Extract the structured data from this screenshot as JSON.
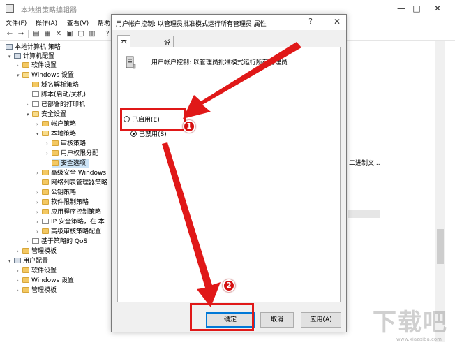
{
  "window": {
    "title": "本地组策略编辑器",
    "controls": {
      "minimize": "—",
      "maximize": "□",
      "close": "✕"
    }
  },
  "menu": {
    "items": [
      "文件(F)",
      "操作(A)",
      "查看(V)",
      "帮助"
    ]
  },
  "tree": {
    "root": "本地计算机 策略",
    "computer_config": "计算机配置",
    "software_settings": "软件设置",
    "windows_settings": "Windows 设置",
    "name_resolution": "域名解析策略",
    "scripts": "脚本(启动/关机)",
    "printers": "已部署的打印机",
    "security_settings": "安全设置",
    "account_policies": "帐户策略",
    "local_policies": "本地策略",
    "audit_policy": "审核策略",
    "user_rights": "用户权限分配",
    "security_options": "安全选项",
    "adv_firewall": "高级安全 Windows",
    "network_list": "网络列表管理器策略",
    "public_key": "公钥策略",
    "software_restriction": "软件限制策略",
    "app_control": "应用程序控制策略",
    "ip_security": "IP 安全策略，在 本",
    "adv_audit": "高级审核策略配置",
    "qos": "基于策略的 QoS",
    "admin_templates": "管理模板",
    "user_config": "用户配置",
    "u_software": "软件设置",
    "u_windows": "Windows 设置",
    "u_admin": "管理模板"
  },
  "right_panel": {
    "partial_text": "二进制文..."
  },
  "dialog": {
    "title": "用户帐户控制: 以管理员批准模式运行所有管理员 属性",
    "close": "?",
    "close_x": "✕",
    "tabs": [
      "本地安全设置",
      "说明"
    ],
    "policy_name": "用户帐户控制: 以管理员批准模式运行所有管理员",
    "options": {
      "enabled": "已启用(E)",
      "disabled": "已禁用(S)",
      "selected": "disabled"
    },
    "buttons": {
      "ok": "确定",
      "cancel": "取消",
      "apply": "应用(A)"
    }
  },
  "annotations": {
    "step1": "1",
    "step2": "2",
    "accent": "#e01818"
  },
  "watermark": {
    "text": "下载吧",
    "url": "www.xiazaiba.com"
  }
}
